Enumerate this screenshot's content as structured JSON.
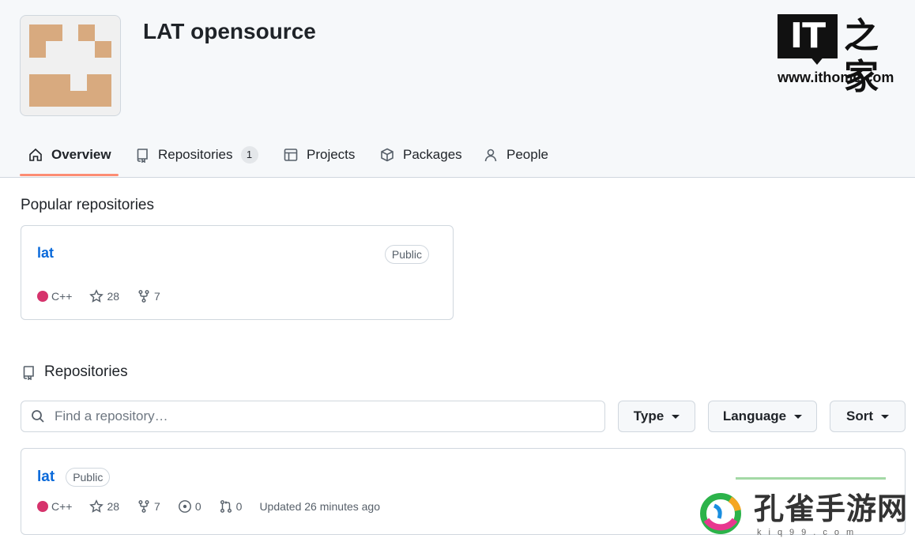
{
  "org": {
    "name": "LAT opensource"
  },
  "watermarks": {
    "it_logo": "IT",
    "it_chars": "之家",
    "it_url": "www.ithome.com",
    "kq_text": "孔雀手游网",
    "kq_url": "kiq99.com"
  },
  "tabs": [
    {
      "label": "Overview",
      "icon": "home-icon",
      "active": true
    },
    {
      "label": "Repositories",
      "icon": "repo-icon",
      "count": "1"
    },
    {
      "label": "Projects",
      "icon": "table-icon"
    },
    {
      "label": "Packages",
      "icon": "package-icon"
    },
    {
      "label": "People",
      "icon": "person-icon"
    }
  ],
  "popular": {
    "title": "Popular repositories",
    "repo": {
      "name": "lat",
      "visibility": "Public",
      "language": "C++",
      "stars": "28",
      "forks": "7"
    }
  },
  "repositories": {
    "title": "Repositories",
    "search_placeholder": "Find a repository…",
    "filters": {
      "type": "Type",
      "language": "Language",
      "sort": "Sort"
    },
    "items": [
      {
        "name": "lat",
        "visibility": "Public",
        "language": "C++",
        "stars": "28",
        "forks": "7",
        "issues": "0",
        "pulls": "0",
        "updated": "Updated 26 minutes ago"
      }
    ]
  },
  "colors": {
    "accent_underline": "#fd8c73",
    "link": "#0969da",
    "cpp_language": "#d6336c",
    "avatar_tile": "#d8aa7f"
  }
}
